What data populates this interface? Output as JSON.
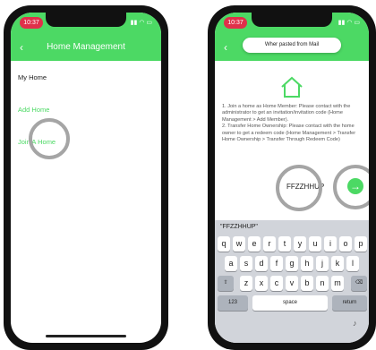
{
  "left_phone": {
    "status_time": "10:37",
    "title": "Home Management",
    "items": [
      "My Home",
      "Add Home",
      "Join A Home"
    ]
  },
  "right_phone": {
    "status_time": "10:37",
    "toast": "Wher pasted from Mail",
    "instructions": "1. Join a home as Home Member: Please contact with the administrator to get an invitation/invitation code (Home Management > Add Member).\n2. Transfer Home Ownership: Please contact with the home owner to get a redeem code (Home Management > Transfer Home Ownership > Transfer Through Redeem Code)",
    "code": "FFZZHHUP",
    "suggestion": "\"FFZZHHUP\"",
    "keyboard": {
      "row1": [
        "q",
        "w",
        "e",
        "r",
        "t",
        "y",
        "u",
        "i",
        "o",
        "p"
      ],
      "row2": [
        "a",
        "s",
        "d",
        "f",
        "g",
        "h",
        "j",
        "k",
        "l"
      ],
      "row3": [
        "z",
        "x",
        "c",
        "v",
        "b",
        "n",
        "m"
      ],
      "numbers": "123",
      "space": "space",
      "return": "return"
    }
  },
  "colors": {
    "accent": "#4cd964",
    "highlight_ring": "#a5a5a5"
  }
}
